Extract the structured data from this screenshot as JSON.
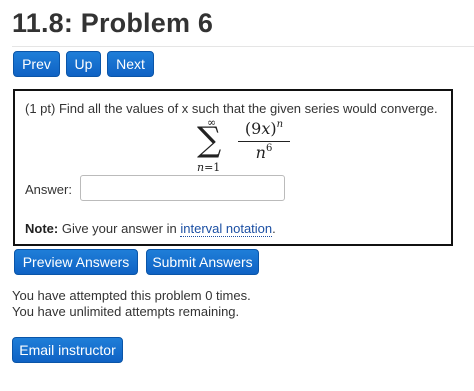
{
  "header": {
    "title": "11.8: Problem 6"
  },
  "nav": {
    "prev_label": "Prev",
    "up_label": "Up",
    "next_label": "Next"
  },
  "problem": {
    "prompt": "(1 pt) Find all the values of x such that the given series would converge.",
    "series": {
      "sum_upper": "∞",
      "sum_lower_var": "n",
      "sum_lower_eq": "=1",
      "numerator_base": "(9",
      "numerator_var": "x",
      "numerator_close": ")",
      "numerator_exp": "n",
      "denominator_base": "n",
      "denominator_exp": "6"
    },
    "answer_label": "Answer:",
    "answer_value": "",
    "answer_placeholder": "",
    "note_bold": "Note:",
    "note_text": "Give your answer in",
    "note_link": "interval notation",
    "note_period": "."
  },
  "actions": {
    "preview_label": "Preview Answers",
    "submit_label": "Submit Answers"
  },
  "status": {
    "attempts_line": "You have attempted this problem 0 times.",
    "remaining_line": "You have unlimited attempts remaining."
  },
  "footer": {
    "email_label": "Email instructor"
  },
  "colors": {
    "button_blue": "#1f7ed8",
    "link_blue": "#1b4fa3",
    "text": "#333333"
  }
}
